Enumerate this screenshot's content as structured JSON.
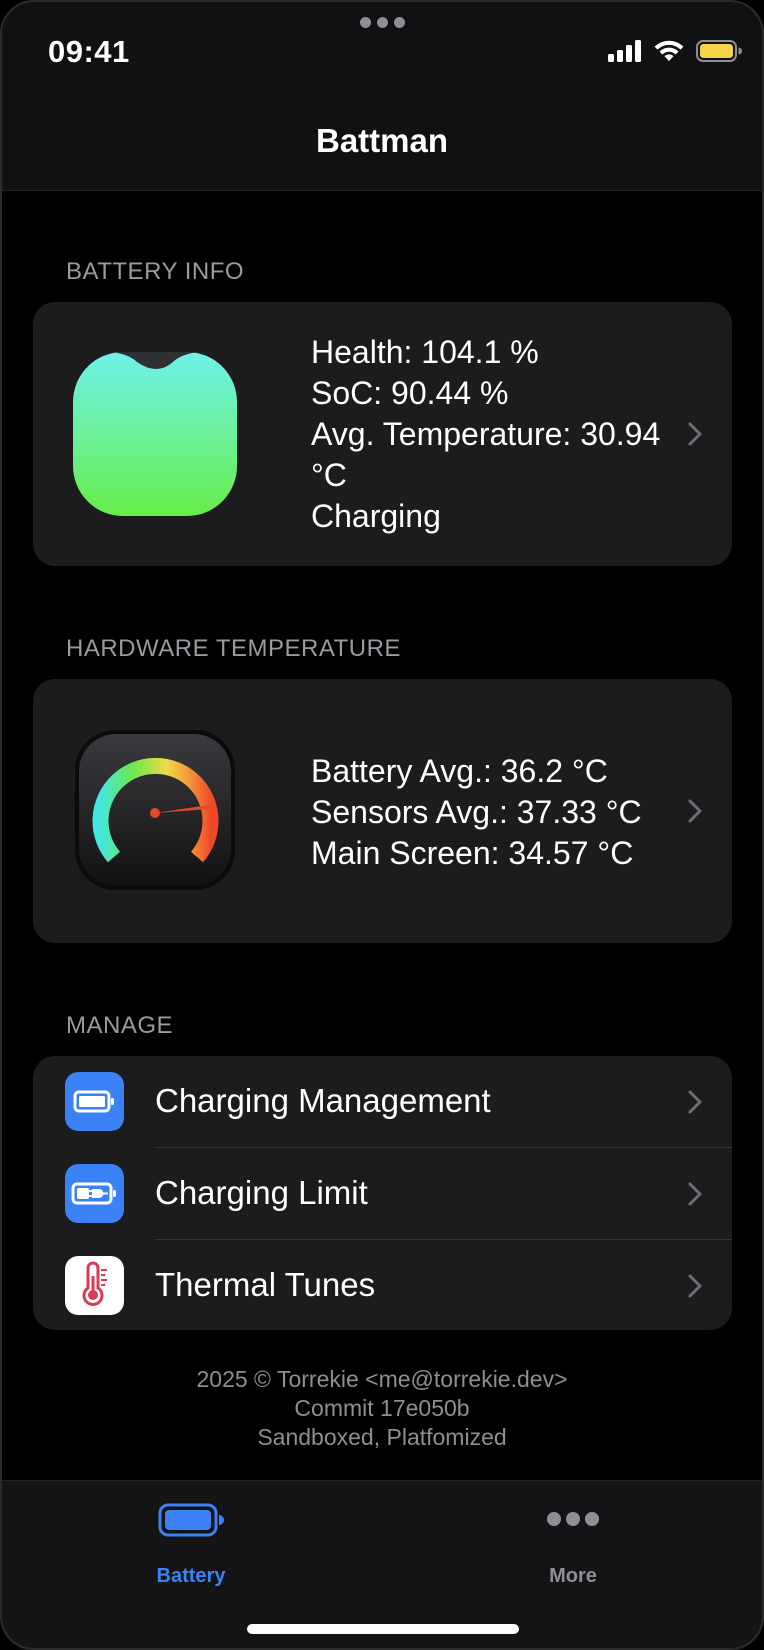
{
  "status_bar": {
    "time": "09:41"
  },
  "nav": {
    "title": "Battman"
  },
  "battery_info": {
    "section_label": "BATTERY INFO",
    "lines": [
      "Health: 104.1 %",
      "SoC: 90.44 %",
      "Avg. Temperature: 30.94",
      "°C",
      "Charging"
    ]
  },
  "hardware_temperature": {
    "section_label": "HARDWARE TEMPERATURE",
    "lines": [
      "Battery Avg.: 36.2 °C",
      "Sensors Avg.: 37.33 °C",
      "Main Screen: 34.57 °C"
    ]
  },
  "manage": {
    "section_label": "MANAGE",
    "items": [
      {
        "label": "Charging Management",
        "icon": "battery-icon"
      },
      {
        "label": "Charging Limit",
        "icon": "battery-plug-icon"
      },
      {
        "label": "Thermal Tunes",
        "icon": "thermometer-icon"
      }
    ]
  },
  "footer": {
    "lines": [
      "2025 © Torrekie <me@torrekie.dev>",
      "Commit 17e050b",
      "Sandboxed, Platfomized"
    ]
  },
  "tabs": [
    {
      "label": "Battery",
      "icon": "battery-icon",
      "selected": true
    },
    {
      "label": "More",
      "icon": "more-icon",
      "selected": false
    }
  ],
  "colors": {
    "accent": "#3b82f6",
    "card": "#1c1c1e",
    "status_battery": "#f5d547",
    "tab_inactive": "#8e8e93"
  }
}
